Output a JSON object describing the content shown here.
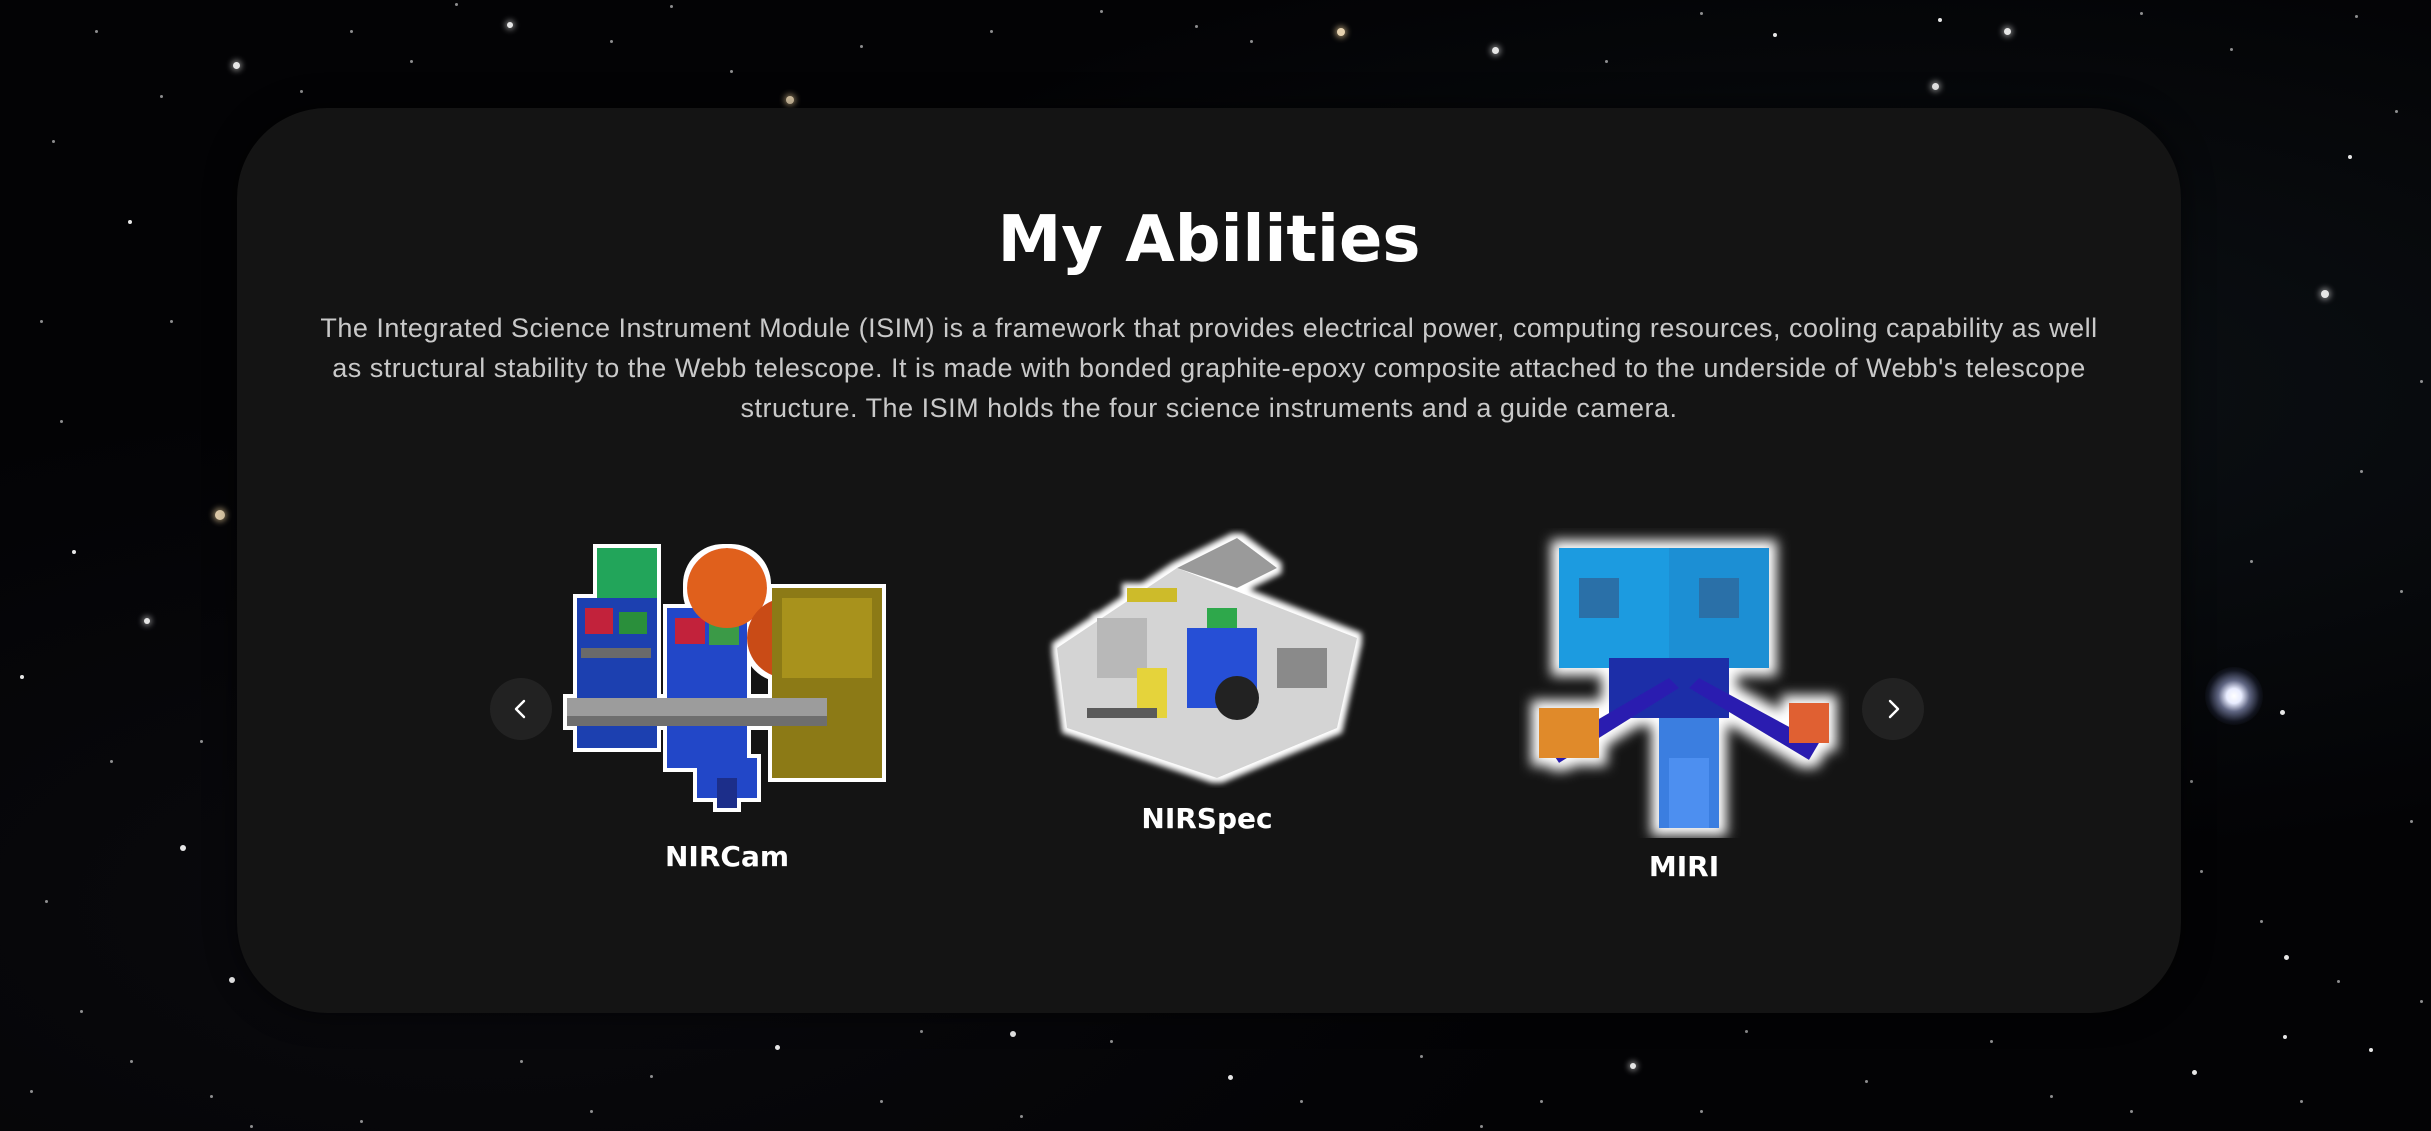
{
  "section": {
    "title": "My Abilities",
    "description": "The Integrated Science Instrument Module (ISIM) is a framework that provides electrical power, computing resources, cooling capability as well as structural stability to the Webb telescope. It is made with bonded graphite-epoxy composite attached to the underside of Webb's telescope structure. The ISIM holds the four science instruments and a guide camera."
  },
  "carousel": {
    "prev_icon": "chevron-left-icon",
    "next_icon": "chevron-right-icon",
    "slides": [
      {
        "label": "NIRCam",
        "image": "nircam-instrument-render"
      },
      {
        "label": "NIRSpec",
        "image": "nirspec-instrument-render"
      },
      {
        "label": "MIRI",
        "image": "miri-instrument-render"
      }
    ]
  },
  "colors": {
    "card_background": "#141414",
    "title": "#ffffff",
    "description": "#c9c9c9",
    "nav_button": "#222222",
    "page_background": "#030305"
  }
}
